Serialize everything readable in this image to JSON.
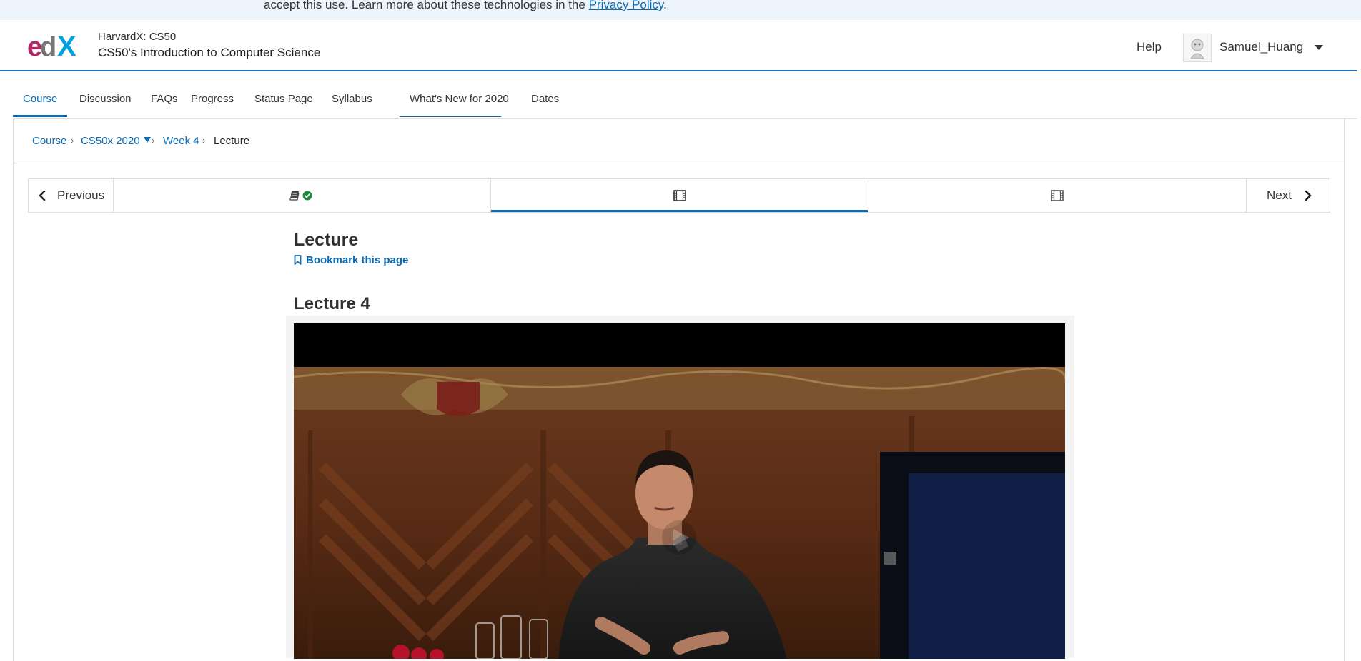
{
  "cookie_banner": {
    "text": "accept this use. Learn more about these technologies in the",
    "link": "Privacy Policy",
    "trailing": "."
  },
  "header": {
    "logo_label": "edX",
    "course_org": "HarvardX: CS50",
    "course_name": "CS50's Introduction to Computer Science",
    "help": "Help",
    "username": "Samuel_Huang"
  },
  "tabs": [
    {
      "label": "Course"
    },
    {
      "label": "Discussion"
    },
    {
      "label": "FAQs"
    },
    {
      "label": "Progress"
    },
    {
      "label": "Status Page"
    },
    {
      "label": "Syllabus"
    },
    {
      "label": "What's New for 2020"
    },
    {
      "label": "Dates"
    }
  ],
  "breadcrumb": {
    "items": [
      "Course",
      "CS50x 2020",
      "Week 4",
      "Lecture"
    ]
  },
  "sequence": {
    "previous": "Previous",
    "next": "Next",
    "items": [
      {
        "icon": "book-icon",
        "completed": true
      },
      {
        "icon": "video-icon",
        "completed": false
      },
      {
        "icon": "video-icon",
        "completed": false
      }
    ]
  },
  "unit": {
    "title": "Lecture",
    "bookmark": "Bookmark this page",
    "video_heading": "Lecture 4"
  },
  "colors": {
    "link": "#0a6ab1",
    "check": "#1e8e3e",
    "header_border": "#1b6fb6"
  }
}
